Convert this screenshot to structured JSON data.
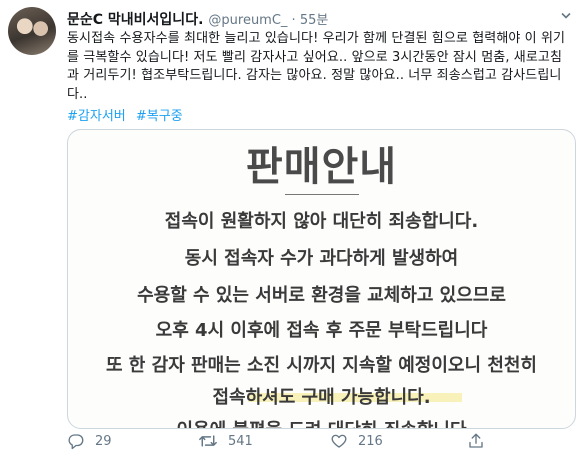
{
  "tweet": {
    "display_name": "문순C 막내비서입니다.",
    "handle": "@pureumC_ · 55분",
    "text": "동시접속 수용자수를 최대한 늘리고 있습니다! 우리가 함께 단결된 힘으로 협력해야 이 위기를 극복할수 있습니다! 저도 빨리 감자사고 싶어요.. 앞으로 3시간동안 잠시 멈춤, 새로고침과 거리두기! 협조부탁드립니다. 감자는 많아요. 정말 많아요.. 너무 죄송스럽고 감사드립니다..",
    "hashtags": [
      "#감자서버",
      "#복구중"
    ]
  },
  "notice_image": {
    "title": "판매안내",
    "lines": [
      "접속이 원활하지 않아 대단히 죄송합니다.",
      "동시 접속자 수가 과다하게 발생하여",
      "수용할 수 있는 서버로 환경을 교체하고 있으므로",
      "오후 4시 이후에 접속 후 주문 부탁드립니다",
      "또 한 감자 판매는 소진 시까지 지속할 예정이오니 천천히",
      "접속하셔도 구매 가능합니다.",
      "이용에 불편을 드려 대단히 죄송합니다"
    ]
  },
  "actions": {
    "reply_count": "29",
    "retweet_count": "541",
    "like_count": "216"
  },
  "colors": {
    "link": "#1da1f2",
    "muted": "#657786",
    "text": "#14171a",
    "highlight": "#f7efb2"
  }
}
